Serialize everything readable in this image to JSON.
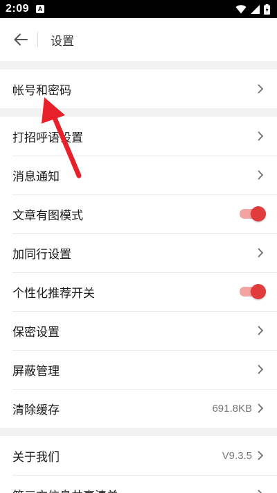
{
  "status_bar": {
    "time": "2:09",
    "notification_badge": "A",
    "icons": [
      "wifi-icon",
      "signal-icon",
      "battery-charging-icon"
    ]
  },
  "header": {
    "title": "设置",
    "back_icon": "arrow-left-icon"
  },
  "groups": [
    {
      "items": [
        {
          "label": "帐号和密码",
          "type": "link"
        }
      ]
    },
    {
      "items": [
        {
          "label": "打招呼语设置",
          "type": "link"
        },
        {
          "label": "消息通知",
          "type": "link"
        },
        {
          "label": "文章有图模式",
          "type": "toggle",
          "on": true
        },
        {
          "label": "加同行设置",
          "type": "link"
        },
        {
          "label": "个性化推荐开关",
          "type": "toggle",
          "on": true
        },
        {
          "label": "保密设置",
          "type": "link"
        },
        {
          "label": "屏蔽管理",
          "type": "link"
        },
        {
          "label": "清除缓存",
          "type": "link",
          "value": "691.8KB"
        }
      ]
    },
    {
      "items": [
        {
          "label": "关于我们",
          "type": "link",
          "value": "V9.3.5"
        },
        {
          "label": "第三方信息共享清单",
          "type": "link"
        }
      ]
    }
  ],
  "colors": {
    "toggle_on": "#e23b3b",
    "toggle_track": "#f4a3a3",
    "annotation_arrow": "#e8202a"
  }
}
